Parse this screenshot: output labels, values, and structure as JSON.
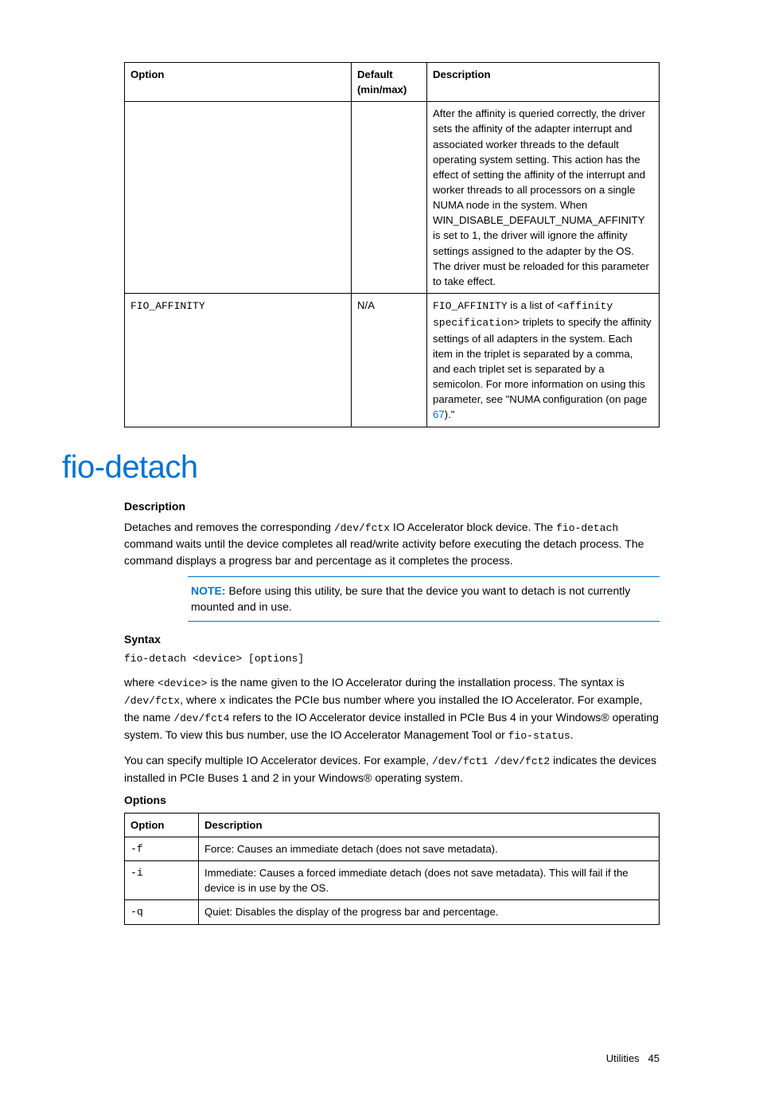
{
  "table1": {
    "headers": {
      "option": "Option",
      "default": "Default (min/max)",
      "description": "Description"
    },
    "rows": [
      {
        "option": "",
        "default": "",
        "desc": "After the affinity is queried correctly, the driver sets the affinity of the adapter interrupt and associated worker threads to the default operating system setting. This action has the effect of setting the affinity of the interrupt and worker threads to all processors on a single NUMA node in the system. When WIN_DISABLE_DEFAULT_NUMA_AFFINITY is set to 1, the driver will ignore the affinity settings assigned to the adapter by the OS. The driver must be reloaded for this parameter to take effect."
      },
      {
        "option": "FIO_AFFINITY",
        "default": "N/A",
        "desc_pre": "FIO_AFFINITY",
        "desc_mid": " is a list of ",
        "desc_code": "<affinity specification>",
        "desc_post1": " triplets to specify the affinity settings of all adapters in the system. Each item in the triplet is separated by a comma, and each triplet set is separated by a semicolon. For more information on using this parameter, see \"NUMA configuration (on page ",
        "desc_page": "67",
        "desc_post2": ").\""
      }
    ]
  },
  "section_title": "fio-detach",
  "desc_label": "Description",
  "desc_p1a": "Detaches and removes the corresponding ",
  "desc_p1_code1": "/dev/fctx",
  "desc_p1b": " IO Accelerator block device. The ",
  "desc_p1_code2": "fio-detach",
  "desc_p1c": " command waits until the device completes all read/write activity before executing the detach process. The command displays a progress bar and percentage as it completes the process.",
  "note_label": "NOTE:",
  "note_text": "   Before using this utility, be sure that the device you want to detach is not currently mounted and in use.",
  "syntax_label": "Syntax",
  "syntax_code": "fio-detach <device> [options]",
  "syntax_p1a": "where ",
  "syntax_p1_code1": "<device>",
  "syntax_p1b": " is the name given to the IO Accelerator during the installation process. The syntax is ",
  "syntax_p1_code2": "/dev/fctx",
  "syntax_p1c": ", where ",
  "syntax_p1_code3": "x",
  "syntax_p1d": " indicates the PCIe bus number where you installed the IO Accelerator. For example, the name ",
  "syntax_p1_code4": "/dev/fct4",
  "syntax_p1e": " refers to the IO Accelerator device installed in PCIe Bus 4 in your Windows® operating system. To view this bus number, use the IO Accelerator Management Tool or ",
  "syntax_p1_code5": "fio-status",
  "syntax_p1f": ".",
  "syntax_p2a": "You can specify multiple IO Accelerator devices. For example, ",
  "syntax_p2_code1": "/dev/fct1 /dev/fct2",
  "syntax_p2b": " indicates the devices installed in PCIe Buses 1 and 2 in your Windows® operating system.",
  "options_label": "Options",
  "options_table": {
    "headers": {
      "option": "Option",
      "description": "Description"
    },
    "rows": [
      {
        "option": "-f",
        "desc": "Force: Causes an immediate detach (does not save metadata)."
      },
      {
        "option": "-i",
        "desc": "Immediate: Causes a forced immediate detach (does not save metadata). This will fail if the device is in use by the OS."
      },
      {
        "option": "-q",
        "desc": "Quiet: Disables the display of the progress bar and percentage."
      }
    ]
  },
  "footer": {
    "label": "Utilities",
    "page": "45"
  }
}
